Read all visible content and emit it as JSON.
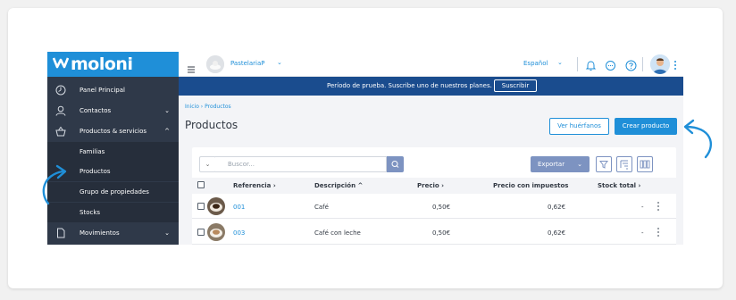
{
  "brand": {
    "name": "moloni",
    "color": "#1f8fd8"
  },
  "sidebar": {
    "items": [
      {
        "label": "Panel Principal",
        "icon": "dashboard-icon"
      },
      {
        "label": "Contactos",
        "icon": "user-icon",
        "chevron": "⌄"
      },
      {
        "label": "Productos & servicios",
        "icon": "basket-icon",
        "chevron": "^"
      },
      {
        "label": "Familias"
      },
      {
        "label": "Productos"
      },
      {
        "label": "Grupo de propiedades"
      },
      {
        "label": "Stocks"
      },
      {
        "label": "Movimientos",
        "icon": "document-icon",
        "chevron": "⌄"
      }
    ]
  },
  "topbar": {
    "company": "PastelariaP",
    "language": "Español"
  },
  "banner": {
    "text": "Período de prueba. Suscribe uno de nuestros planes.",
    "button": "Suscribir"
  },
  "breadcrumb": "Inicio › Productos",
  "page_title": "Productos",
  "actions": {
    "orphans": "Ver huérfanos",
    "create": "Crear producto"
  },
  "toolbar": {
    "search_placeholder": "Buscor...",
    "export": "Exportar"
  },
  "table": {
    "columns": {
      "reference": "Referencia  ›",
      "description": "Descripción  ^",
      "price": "Precio  ›",
      "price_tax": "Precio con impuestos",
      "stock": "Stock total  ›"
    },
    "rows": [
      {
        "ref": "001",
        "description": "Café",
        "price": "0,50€",
        "price_tax": "0,62€",
        "stock": "-"
      },
      {
        "ref": "003",
        "description": "Café con leche",
        "price": "0,50€",
        "price_tax": "0,62€",
        "stock": "-"
      }
    ]
  },
  "colors": {
    "sidebar": "#2f3949",
    "banner": "#1a4c8e",
    "accent": "#1f8fd8",
    "secondary": "#7d93c1"
  }
}
